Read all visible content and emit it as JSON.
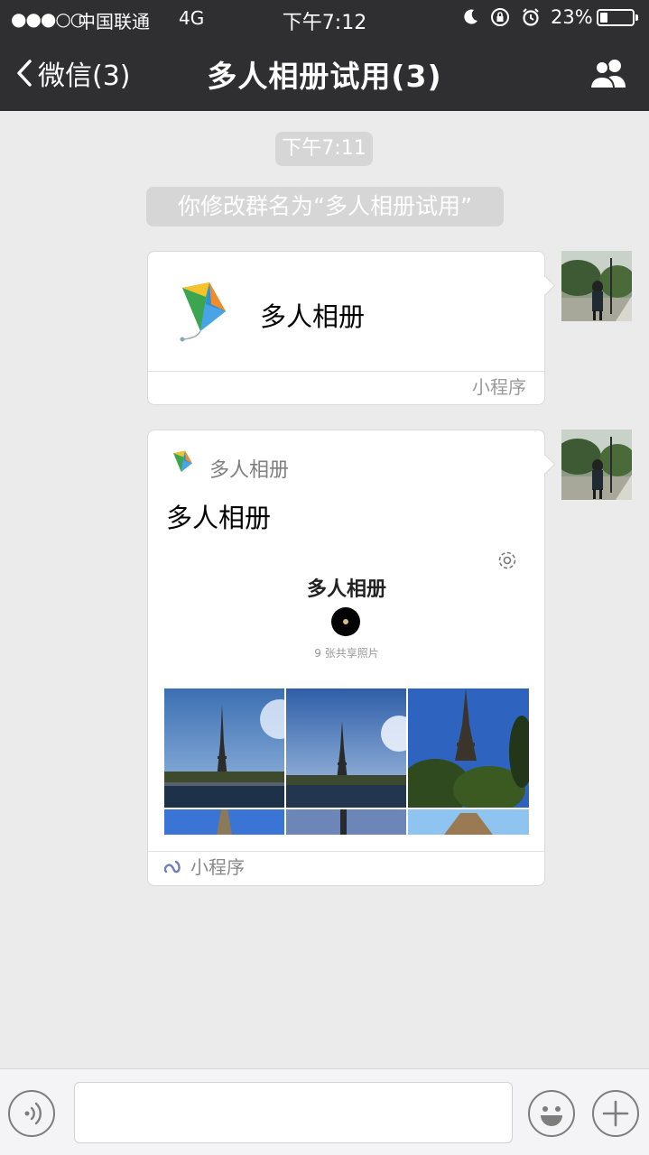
{
  "status_bar": {
    "signal": "●●●○○",
    "carrier": "中国联通",
    "network": "4G",
    "time": "下午7:12",
    "battery_text": "23%",
    "battery_level": 0.23
  },
  "nav": {
    "back_label": "微信(3)",
    "title": "多人相册试用(3)"
  },
  "chat": {
    "timestamp": "下午7:11",
    "system_message": "你修改群名为“多人相册试用”",
    "message1": {
      "name": "多人相册",
      "tag": "小程序"
    },
    "message2": {
      "source_name": "多人相册",
      "title": "多人相册",
      "preview": {
        "title": "多人相册",
        "count_text": "9 张共享照片"
      },
      "tag": "小程序"
    }
  },
  "colors": {
    "nav_bar": "#2f2f31",
    "chat_background": "#ebebeb",
    "pill": "#d6d6d6"
  }
}
